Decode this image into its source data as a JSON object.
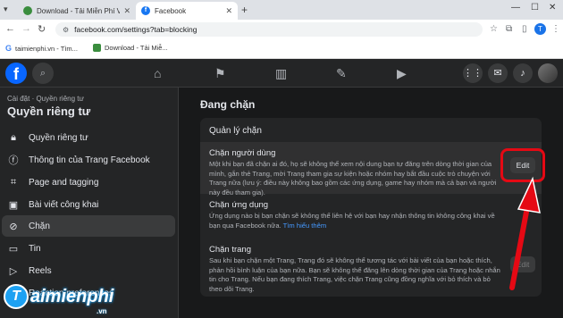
{
  "browser": {
    "tabs": [
      {
        "label": "Download - Tải Miễn Phí VN - Ph",
        "active": false
      },
      {
        "label": "Facebook",
        "active": true
      }
    ],
    "url": "facebook.com/settings?tab=blocking",
    "bookmarks": [
      {
        "label": "taimienphi.vn - Tìm..."
      },
      {
        "label": "Download - Tải Miễ..."
      }
    ],
    "profile_initial": "T"
  },
  "sidebar": {
    "breadcrumb": "Cài đặt · Quyền riêng tư",
    "title": "Quyền riêng tư",
    "items": [
      {
        "label": "Quyền riêng tư",
        "icon": "lock-icon"
      },
      {
        "label": "Thông tin của Trang Facebook",
        "icon": "facebook-circle-icon"
      },
      {
        "label": "Page and tagging",
        "icon": "tag-icon"
      },
      {
        "label": "Bài viết công khai",
        "icon": "public-post-icon"
      },
      {
        "label": "Chặn",
        "icon": "block-user-icon",
        "active": true
      },
      {
        "label": "Tin",
        "icon": "story-icon"
      },
      {
        "label": "Reels",
        "icon": "reels-icon"
      },
      {
        "label": "Reaction preferences",
        "icon": "reaction-icon"
      }
    ]
  },
  "main": {
    "title": "Đang chặn",
    "card_heading": "Quản lý chặn",
    "sections": [
      {
        "title": "Chặn người dùng",
        "desc": "Một khi bạn đã chặn ai đó, họ sẽ không thể xem nội dung bạn tự đăng trên dòng thời gian của mình, gắn thẻ Trang, mời Trang tham gia sự kiện hoặc nhóm hay bắt đầu cuộc trò chuyện với Trang nữa (lưu ý: điều này không bao gồm các ứng dụng, game hay nhóm mà cả bạn và người này đều tham gia).",
        "button": "Edit"
      },
      {
        "title": "Chặn ứng dụng",
        "desc": "Ứng dụng nào bị bạn chặn sẽ không thể liên hệ với bạn hay nhận thông tin không công khai về bạn qua Facebook nữa.",
        "link": "Tìm hiểu thêm"
      },
      {
        "title": "Chặn trang",
        "desc": "Sau khi bạn chặn một Trang, Trang đó sẽ không thể tương tác với bài viết của bạn hoặc thích, phản hồi bình luận của bạn nữa. Bạn sẽ không thể đăng lên dòng thời gian của Trang hoặc nhắn tin cho Trang. Nếu bạn đang thích Trang, việc chặn Trang cũng đồng nghĩa với bỏ thích và bỏ theo dõi Trang.",
        "button": "Edit"
      }
    ]
  },
  "watermark": {
    "logo": "T",
    "text": "aimienphi",
    "suffix": ".vn"
  },
  "colors": {
    "fb_blue": "#0866ff",
    "highlight_red": "#e50914",
    "link": "#4599ff"
  }
}
